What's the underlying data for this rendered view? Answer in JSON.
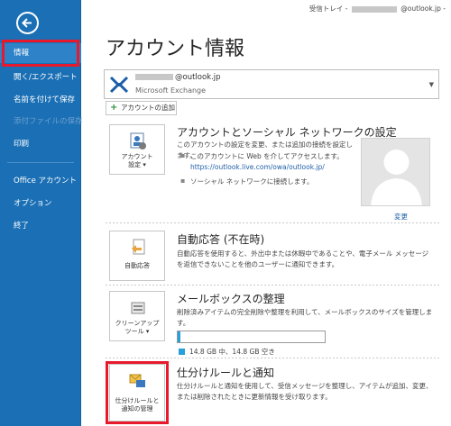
{
  "header": {
    "inbox_prefix": "受信トレイ -",
    "inbox_suffix": "@outlook.jp -"
  },
  "sidebar": {
    "items": [
      {
        "label": "情報",
        "state": "active"
      },
      {
        "label": "開く/エクスポート",
        "state": "normal"
      },
      {
        "label": "名前を付けて保存",
        "state": "normal"
      },
      {
        "label": "添付ファイルの保存",
        "state": "disabled"
      },
      {
        "label": "印刷",
        "state": "normal"
      },
      {
        "label": "Office アカウント",
        "state": "normal"
      },
      {
        "label": "オプション",
        "state": "normal"
      },
      {
        "label": "終了",
        "state": "normal"
      }
    ]
  },
  "main": {
    "title": "アカウント情報",
    "account": {
      "email_suffix": "@outlook.jp",
      "type": "Microsoft Exchange"
    },
    "add_account_label": "アカウントの追加",
    "account_settings": {
      "tile_label_1": "アカウント",
      "tile_label_2": "設定",
      "title": "アカウントとソーシャル ネットワークの設定",
      "desc": "このアカウントの設定を変更、または追加の接続を設定します。",
      "bullet1": "このアカウントに Web を介してアクセスします。",
      "link": "https://outlook.live.com/owa/outlook.jp/",
      "bullet2": "ソーシャル ネットワークに接続します。",
      "change_label": "変更"
    },
    "auto_reply": {
      "tile_label": "自動応答",
      "title": "自動応答 (不在時)",
      "desc": "自動応答を使用すると、外出中または休暇中であることや、電子メール メッセージを返信できないことを他のユーザーに通知できます。"
    },
    "mailbox": {
      "tile_label_1": "クリーンアップ",
      "tile_label_2": "ツール",
      "title": "メールボックスの整理",
      "desc": "削除済みアイテムの完全削除や整理を利用して、メールボックスのサイズを管理します。",
      "usage_text": "14.8 GB 中、14.8 GB 空き",
      "used_fraction": 0.02
    },
    "rules": {
      "tile_label_1": "仕分けルールと",
      "tile_label_2": "通知の管理",
      "title": "仕分けルールと通知",
      "desc": "仕分けルールと通知を使用して、受信メッセージを整理し、アイテムが追加、変更、または削除されたときに更新情報を受け取ります。"
    }
  },
  "colors": {
    "sidebar": "#1a6fb5",
    "highlight": "#e8192c",
    "link": "#1f5fa8"
  }
}
